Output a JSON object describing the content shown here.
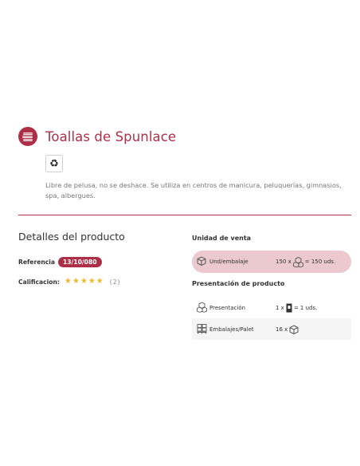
{
  "product": {
    "title": "Toallas de Spunlace",
    "recycle_symbol": "♻",
    "description": "Libre de pelusa, no se deshace. Se utiliza en centros de manicura, peluquerías, gimnasios, spa, albergues."
  },
  "details": {
    "heading": "Detalles del producto",
    "reference_label": "Referencia",
    "reference_value": "13/10/080",
    "rating_label": "Calificacion:",
    "rating_stars": "★★★★★",
    "rating_count": "(2)"
  },
  "unit_sale": {
    "heading": "Unidad de venta",
    "row": {
      "label": "Und/embalaje",
      "qty": "150 x",
      "result": "= 150 uds."
    }
  },
  "presentation": {
    "heading": "Presentación de producto",
    "rows": [
      {
        "label": "Presentación",
        "qty": "1 x",
        "result": "= 1 uds."
      },
      {
        "label": "Embalajes/Palet",
        "qty": "16 x",
        "result": ""
      }
    ]
  },
  "colors": {
    "brand": "#ad2f47",
    "highlight": "#ebc9cf",
    "star": "#f0b92c"
  },
  "icons": [
    "towel-stack-icon",
    "recycle-icon",
    "box-icon",
    "unit-icon",
    "pallet-icon"
  ]
}
